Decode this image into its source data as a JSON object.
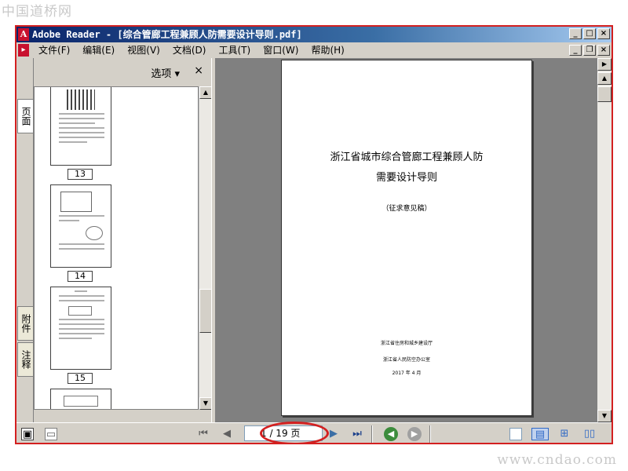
{
  "watermarks": {
    "top": "中国道桥网",
    "bottom": "www.cndao.com"
  },
  "window": {
    "app_icon": "adobe-reader-icon",
    "title": "Adobe Reader - [综合管廊工程兼顾人防需要设计导则.pdf]",
    "controls": {
      "minimize": "_",
      "maximize": "□",
      "close": "×"
    }
  },
  "menubar": {
    "items": [
      {
        "label": "文件",
        "key": "(F)"
      },
      {
        "label": "编辑",
        "key": "(E)"
      },
      {
        "label": "视图",
        "key": "(V)"
      },
      {
        "label": "文档",
        "key": "(D)"
      },
      {
        "label": "工具",
        "key": "(T)"
      },
      {
        "label": "窗口",
        "key": "(W)"
      },
      {
        "label": "帮助",
        "key": "(H)"
      }
    ],
    "doc_controls": {
      "minimize": "_",
      "restore": "❐",
      "close": "×"
    }
  },
  "navtabs": {
    "pages": "页面",
    "attachments": "附件",
    "comments": "注释"
  },
  "panel": {
    "options": "选项 ▾",
    "close": "×",
    "thumbnails": [
      {
        "number": "13"
      },
      {
        "number": "14"
      },
      {
        "number": "15"
      }
    ]
  },
  "document": {
    "title_line1": "浙江省城市综合管廊工程兼顾人防",
    "title_line2": "需要设计导则",
    "draft": "（征求意见稿）",
    "org1": "浙江省住房和城乡建设厅",
    "org2": "浙江省人民防空办公室",
    "date": "2017 年 4 月"
  },
  "bottombar": {
    "page_display": "1 / 19 页",
    "current_page": 1,
    "total_pages": 19
  }
}
